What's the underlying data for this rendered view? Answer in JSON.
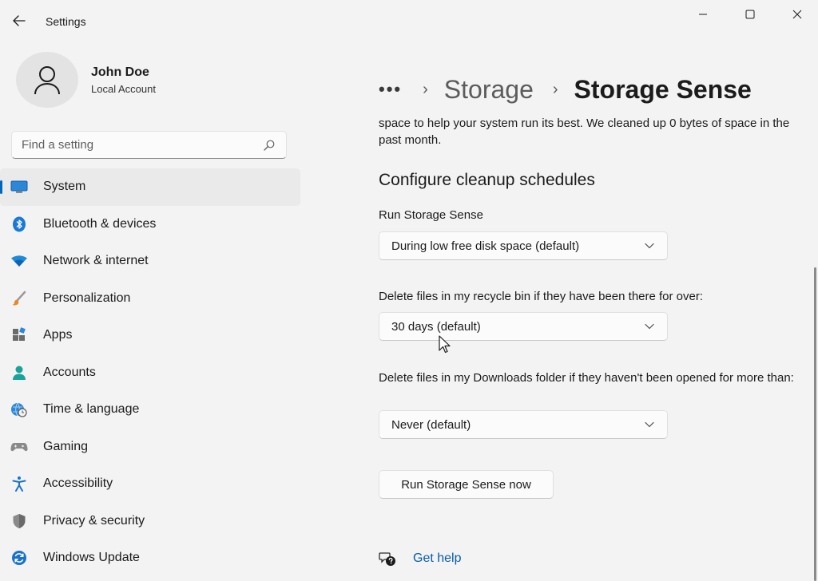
{
  "window": {
    "title": "Settings"
  },
  "profile": {
    "name": "John Doe",
    "account_type": "Local Account"
  },
  "search": {
    "placeholder": "Find a setting"
  },
  "sidebar": {
    "items": [
      {
        "label": "System",
        "icon": "system-icon",
        "active": true
      },
      {
        "label": "Bluetooth & devices",
        "icon": "bluetooth-icon"
      },
      {
        "label": "Network & internet",
        "icon": "wifi-icon"
      },
      {
        "label": "Personalization",
        "icon": "brush-icon"
      },
      {
        "label": "Apps",
        "icon": "apps-icon"
      },
      {
        "label": "Accounts",
        "icon": "accounts-icon"
      },
      {
        "label": "Time & language",
        "icon": "globe-clock-icon"
      },
      {
        "label": "Gaming",
        "icon": "gamepad-icon"
      },
      {
        "label": "Accessibility",
        "icon": "accessibility-icon"
      },
      {
        "label": "Privacy & security",
        "icon": "shield-icon"
      },
      {
        "label": "Windows Update",
        "icon": "update-icon"
      }
    ]
  },
  "breadcrumb": {
    "dots": "•••",
    "parent": "Storage",
    "current": "Storage Sense"
  },
  "main": {
    "description": "space to help your system run its best. We cleaned up 0 bytes of space in the past month.",
    "section_title": "Configure cleanup schedules",
    "run_label": "Run Storage Sense",
    "run_value": "During low free disk space (default)",
    "recycle_label": "Delete files in my recycle bin if they have been there for over:",
    "recycle_value": "30 days (default)",
    "downloads_label": "Delete files in my Downloads folder if they haven't been opened for more than:",
    "downloads_value": "Never (default)",
    "run_now_button": "Run Storage Sense now",
    "get_help": "Get help"
  },
  "colors": {
    "accent": "#0067c0",
    "link": "#0b5cad",
    "background": "#f3f3f3"
  }
}
